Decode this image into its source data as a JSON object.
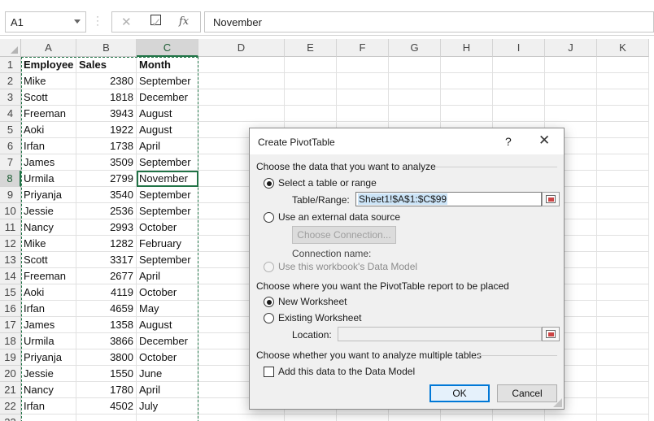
{
  "formula_bar": {
    "name_box": "A1",
    "cancel_glyph": "✕",
    "enter_glyph": "✓",
    "fx_label": "fx",
    "formula": "November"
  },
  "columns": [
    "A",
    "B",
    "C",
    "D",
    "E",
    "F",
    "G",
    "H",
    "I",
    "J",
    "K"
  ],
  "selected_column": "C",
  "selected_row": "8",
  "rows": [
    {
      "n": "1",
      "a": "Employee",
      "b": "Sales",
      "c": "Month"
    },
    {
      "n": "2",
      "a": "Mike",
      "b": "2380",
      "c": "September"
    },
    {
      "n": "3",
      "a": "Scott",
      "b": "1818",
      "c": "December"
    },
    {
      "n": "4",
      "a": "Freeman",
      "b": "3943",
      "c": "August"
    },
    {
      "n": "5",
      "a": "Aoki",
      "b": "1922",
      "c": "August"
    },
    {
      "n": "6",
      "a": "Irfan",
      "b": "1738",
      "c": "April"
    },
    {
      "n": "7",
      "a": "James",
      "b": "3509",
      "c": "September"
    },
    {
      "n": "8",
      "a": "Urmila",
      "b": "2799",
      "c": "November"
    },
    {
      "n": "9",
      "a": "Priyanja",
      "b": "3540",
      "c": "September"
    },
    {
      "n": "10",
      "a": "Jessie",
      "b": "2536",
      "c": "September"
    },
    {
      "n": "11",
      "a": "Nancy",
      "b": "2993",
      "c": "October"
    },
    {
      "n": "12",
      "a": "Mike",
      "b": "1282",
      "c": "February"
    },
    {
      "n": "13",
      "a": "Scott",
      "b": "3317",
      "c": "September"
    },
    {
      "n": "14",
      "a": "Freeman",
      "b": "2677",
      "c": "April"
    },
    {
      "n": "15",
      "a": "Aoki",
      "b": "4119",
      "c": "October"
    },
    {
      "n": "16",
      "a": "Irfan",
      "b": "4659",
      "c": "May"
    },
    {
      "n": "17",
      "a": "James",
      "b": "1358",
      "c": "August"
    },
    {
      "n": "18",
      "a": "Urmila",
      "b": "3866",
      "c": "December"
    },
    {
      "n": "19",
      "a": "Priyanja",
      "b": "3800",
      "c": "October"
    },
    {
      "n": "20",
      "a": "Jessie",
      "b": "1550",
      "c": "June"
    },
    {
      "n": "21",
      "a": "Nancy",
      "b": "1780",
      "a2": "",
      "c": "April"
    },
    {
      "n": "22",
      "a": "Irfan",
      "b": "4502",
      "c": "July"
    }
  ],
  "dialog": {
    "title": "Create PivotTable",
    "help": "?",
    "close": "✕",
    "section1": "Choose the data that you want to analyze",
    "opt_table": "Select a table or range",
    "table_range_label": "Table/Range:",
    "table_range_value": "Sheet1!$A$1:$C$99",
    "opt_external": "Use an external data source",
    "choose_connection": "Choose Connection...",
    "connection_name_label": "Connection name:",
    "opt_data_model": "Use this workbook's Data Model",
    "section2": "Choose where you want the PivotTable report to be placed",
    "opt_new_ws": "New Worksheet",
    "opt_existing_ws": "Existing Worksheet",
    "location_label": "Location:",
    "location_value": "",
    "section3": "Choose whether you want to analyze multiple tables",
    "add_to_model": "Add this data to the Data Model",
    "ok": "OK",
    "cancel": "Cancel"
  },
  "colors": {
    "accent_green": "#217346",
    "ok_border": "#0078d7"
  }
}
